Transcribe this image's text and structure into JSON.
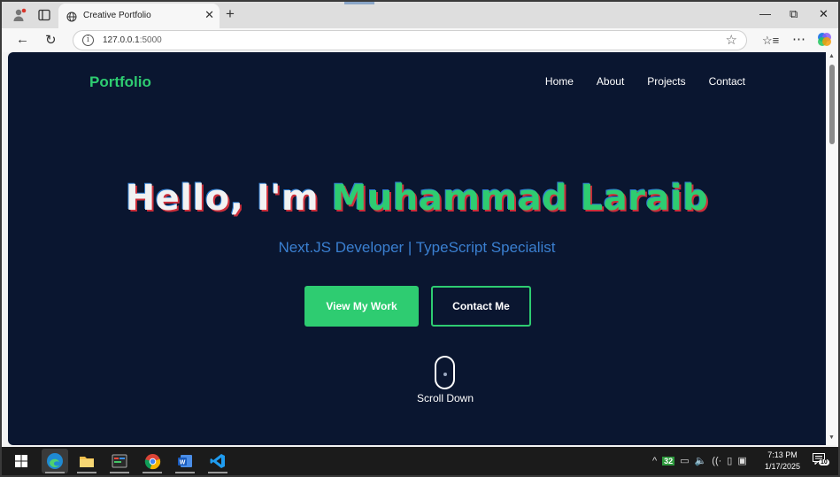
{
  "browser": {
    "tab_title": "Creative Portfolio",
    "url_host": "127.0.0.1",
    "url_port": ":5000"
  },
  "site": {
    "brand": "Portfolio",
    "nav": [
      "Home",
      "About",
      "Projects",
      "Contact"
    ],
    "hero_greeting": "Hello, I'm",
    "hero_name": "Muhammad Laraib",
    "subtitle": "Next.JS Developer | TypeScript Specialist",
    "primary_button": "View My Work",
    "secondary_button": "Contact Me",
    "scroll_label": "Scroll Down"
  },
  "taskbar": {
    "apps": [
      "windows-start-icon",
      "edge-icon",
      "file-explorer-icon",
      "terminal-icon",
      "chrome-icon",
      "word-icon",
      "vscode-icon"
    ],
    "battery_level": "32",
    "time": "7:13 PM",
    "date": "1/17/2025",
    "notification_count": "10"
  },
  "colors": {
    "accent_green": "#2ecc71",
    "page_background": "#0a1630",
    "subtitle_blue": "#3a7fd0"
  }
}
